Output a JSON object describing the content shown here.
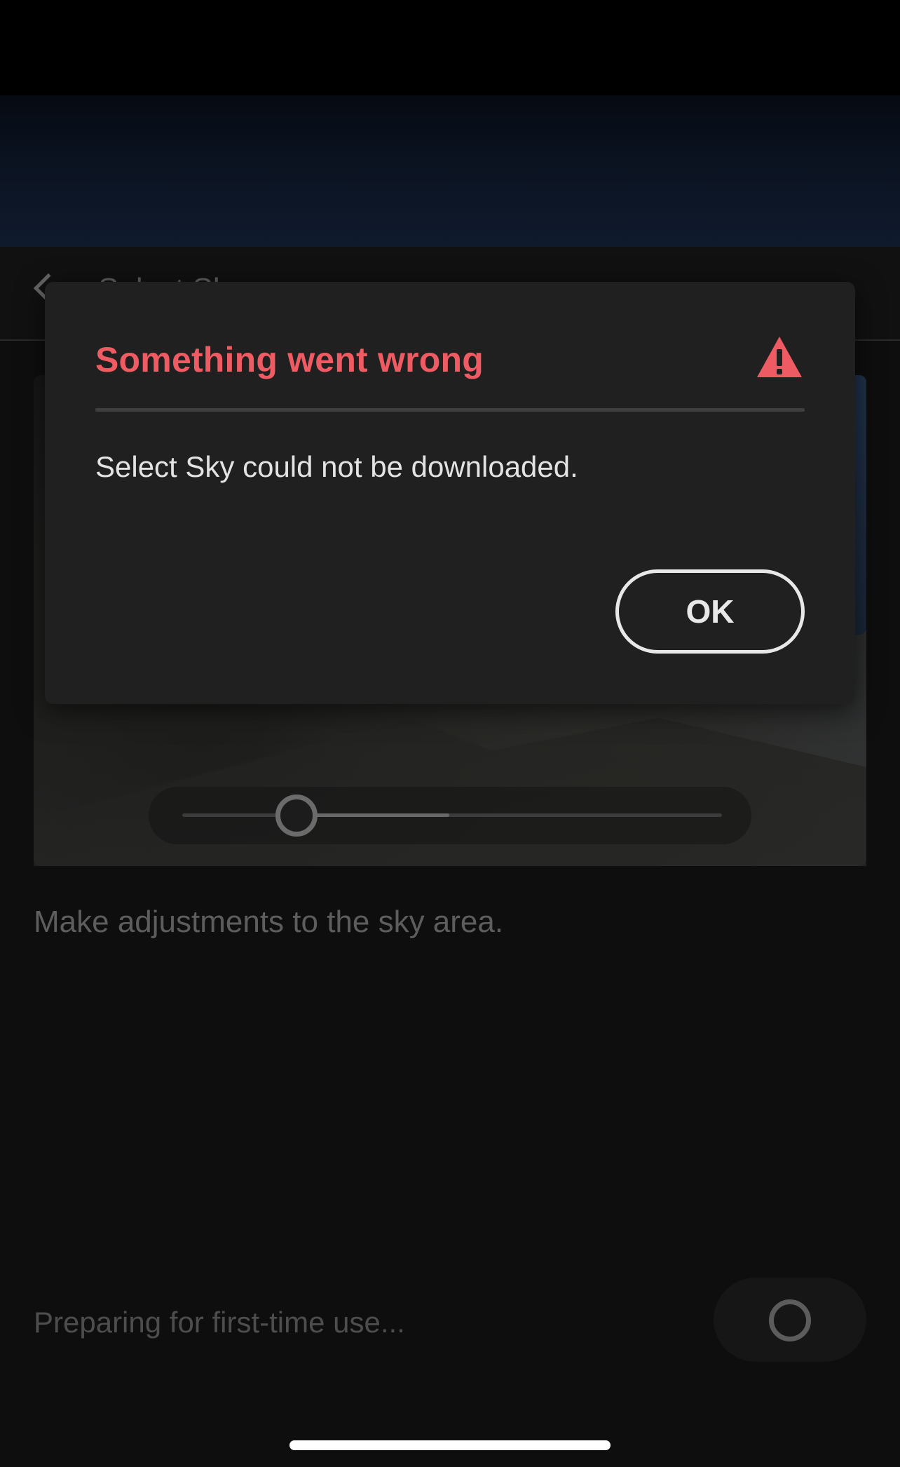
{
  "header": {
    "title": "Select Sky"
  },
  "main": {
    "hint": "Make adjustments to the sky area.",
    "slider_value_fraction": 0.2
  },
  "footer": {
    "status": "Preparing for first-time use..."
  },
  "dialog": {
    "title": "Something went wrong",
    "message": "Select Sky could not be downloaded.",
    "ok_label": "OK",
    "icon": "warning-icon"
  },
  "colors": {
    "error_accent": "#ef5b63",
    "dialog_background": "#202021",
    "app_background": "#0e0e0e"
  }
}
